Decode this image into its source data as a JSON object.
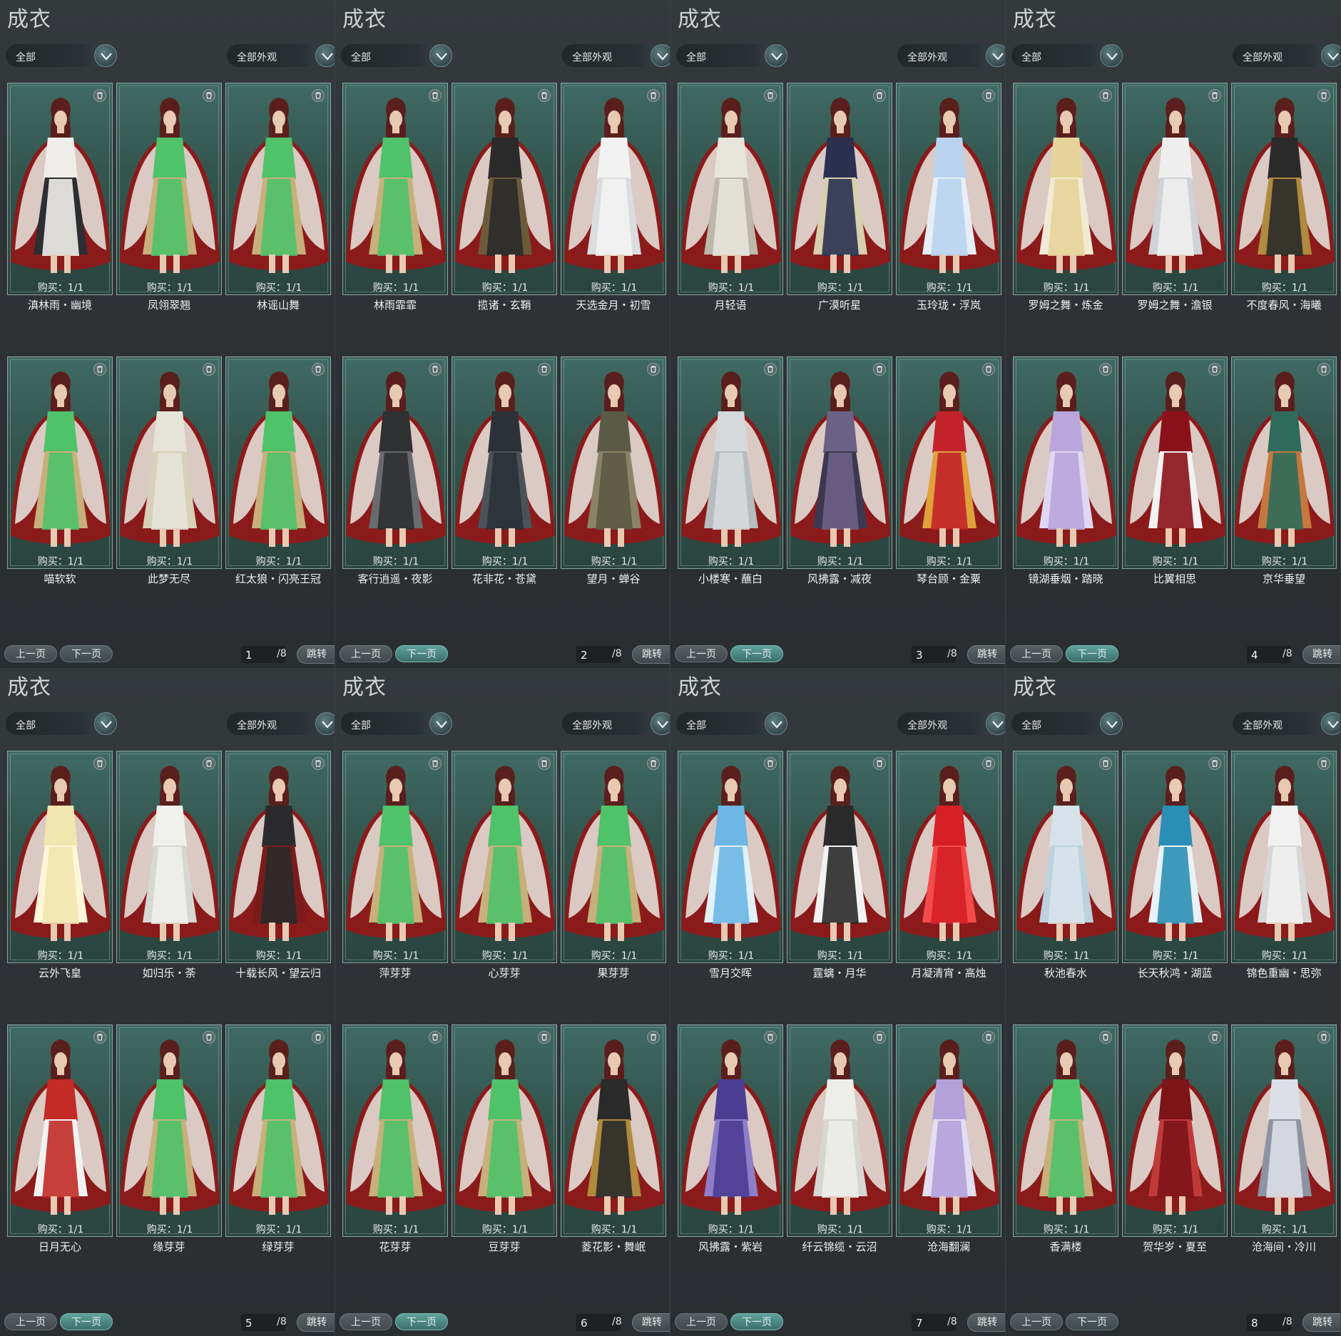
{
  "panels": [
    {
      "title": "成衣",
      "filter_left": "全部",
      "filter_right": "全部外观",
      "page": "1",
      "total": "/8",
      "prev_label": "上一页",
      "next_label": "下一页",
      "next_active": false,
      "jump_label": "跳转",
      "items": [
        {
          "buy": "购买：1/1",
          "name": "滇林雨・幽境",
          "colors": [
            "#f0eeea",
            "#2b2f33",
            "#8b1b1b"
          ]
        },
        {
          "buy": "购买：1/1",
          "name": "凤翎翠翘",
          "colors": [
            "#4fc26a",
            "#c8b07a",
            "#8b1b1b"
          ]
        },
        {
          "buy": "购买：1/1",
          "name": "林谣山舞",
          "colors": [
            "#4fc26a",
            "#c8b07a",
            "#8b1b1b"
          ]
        },
        {
          "buy": "购买：1/1",
          "name": "喵软软",
          "colors": [
            "#4fc26a",
            "#c8b07a",
            "#8b1b1b"
          ]
        },
        {
          "buy": "购买：1/1",
          "name": "此梦无尽",
          "colors": [
            "#e6e3d9",
            "#d8d1b8",
            "#8b1b1b"
          ]
        },
        {
          "buy": "购买：1/1",
          "name": "红太狼・闪亮王冠",
          "colors": [
            "#4fc26a",
            "#c8b07a",
            "#8b1b1b"
          ]
        }
      ]
    },
    {
      "title": "成衣",
      "filter_left": "全部",
      "filter_right": "全部外观",
      "page": "2",
      "total": "/8",
      "prev_label": "上一页",
      "next_label": "下一页",
      "next_active": true,
      "jump_label": "跳转",
      "items": [
        {
          "buy": "购买：1/1",
          "name": "林雨霏霏",
          "colors": [
            "#4fc26a",
            "#c8b07a",
            "#8b1b1b"
          ]
        },
        {
          "buy": "购买：1/1",
          "name": "揽诸・玄鞘",
          "colors": [
            "#2a2a2a",
            "#6b5a3a",
            "#8b1b1b"
          ]
        },
        {
          "buy": "购买：1/1",
          "name": "天选金月・初雪",
          "colors": [
            "#f2f2f2",
            "#d9dde0",
            "#8b1b1b"
          ]
        },
        {
          "buy": "购买：1/1",
          "name": "客行逍遥・夜影",
          "colors": [
            "#2f3032",
            "#6a6b6e",
            "#8b1b1b"
          ]
        },
        {
          "buy": "购买：1/1",
          "name": "花非花・苍黛",
          "colors": [
            "#2b3136",
            "#4a5258",
            "#8b1b1b"
          ]
        },
        {
          "buy": "购买：1/1",
          "name": "望月・蝉谷",
          "colors": [
            "#5b5a45",
            "#8a8366",
            "#8b1b1b"
          ]
        }
      ]
    },
    {
      "title": "成衣",
      "filter_left": "全部",
      "filter_right": "全部外观",
      "page": "3",
      "total": "/8",
      "prev_label": "上一页",
      "next_label": "下一页",
      "next_active": true,
      "jump_label": "跳转",
      "items": [
        {
          "buy": "购买：1/1",
          "name": "月轻语",
          "colors": [
            "#e7e4dc",
            "#bdb8aa",
            "#8b1b1b"
          ]
        },
        {
          "buy": "购买：1/1",
          "name": "广漠听星",
          "colors": [
            "#2a3150",
            "#d8cfae",
            "#8b1b1b"
          ]
        },
        {
          "buy": "购买：1/1",
          "name": "玉玲珑・浮岚",
          "colors": [
            "#b9d3ee",
            "#e7eef6",
            "#8b1b1b"
          ]
        },
        {
          "buy": "购买：1/1",
          "name": "小楼寒・蘸白",
          "colors": [
            "#d6d9db",
            "#b7bcbf",
            "#8b1b1b"
          ]
        },
        {
          "buy": "购买：1/1",
          "name": "风拂露・减夜",
          "colors": [
            "#6b6184",
            "#3d3850",
            "#8b1b1b"
          ]
        },
        {
          "buy": "购买：1/1",
          "name": "琴台顾・金粟",
          "colors": [
            "#c2232a",
            "#e0a13a",
            "#8b1b1b"
          ]
        }
      ]
    },
    {
      "title": "成衣",
      "filter_left": "全部",
      "filter_right": "全部外观",
      "page": "4",
      "total": "/8",
      "prev_label": "上一页",
      "next_label": "下一页",
      "next_active": true,
      "jump_label": "跳转",
      "items": [
        {
          "buy": "购买：1/1",
          "name": "罗姆之舞・炼金",
          "colors": [
            "#e7d49a",
            "#f1ead5",
            "#8b1b1b"
          ]
        },
        {
          "buy": "购买：1/1",
          "name": "罗姆之舞・澹银",
          "colors": [
            "#eeeeee",
            "#cfd2d6",
            "#8b1b1b"
          ]
        },
        {
          "buy": "购买：1/1",
          "name": "不度春风・海曦",
          "colors": [
            "#2a2a2a",
            "#b08a3e",
            "#8b1b1b"
          ]
        },
        {
          "buy": "购买：1/1",
          "name": "镜湖垂烟・踏晓",
          "colors": [
            "#b9a6dd",
            "#e0d7f2",
            "#8b1b1b"
          ]
        },
        {
          "buy": "购买：1/1",
          "name": "比翼相思",
          "colors": [
            "#8b1118",
            "#f2f2f2",
            "#8b1b1b"
          ]
        },
        {
          "buy": "购买：1/1",
          "name": "京华垂望",
          "colors": [
            "#2f6b5a",
            "#c6783f",
            "#8b1b1b"
          ]
        }
      ]
    },
    {
      "title": "成衣",
      "filter_left": "全部",
      "filter_right": "全部外观",
      "page": "5",
      "total": "/8",
      "prev_label": "上一页",
      "next_label": "下一页",
      "next_active": true,
      "jump_label": "跳转",
      "items": [
        {
          "buy": "购买：1/1",
          "name": "云外飞皇",
          "colors": [
            "#f2e6b0",
            "#fff7d8",
            "#8b1b1b"
          ]
        },
        {
          "buy": "购买：1/1",
          "name": "如归乐・荼",
          "colors": [
            "#efefec",
            "#d6d8d4",
            "#8b1b1b"
          ]
        },
        {
          "buy": "购买：1/1",
          "name": "十载长风・望云归",
          "colors": [
            "#2a2a2c",
            "#7a1b1b",
            "#8b1b1b"
          ]
        },
        {
          "buy": "购买：1/1",
          "name": "日月无心",
          "colors": [
            "#c22b26",
            "#f2f2f2",
            "#8b1b1b"
          ]
        },
        {
          "buy": "购买：1/1",
          "name": "缘芽芽",
          "colors": [
            "#4fc26a",
            "#c8b07a",
            "#8b1b1b"
          ]
        },
        {
          "buy": "购买：1/1",
          "name": "绿芽芽",
          "colors": [
            "#4fc26a",
            "#c8b07a",
            "#8b1b1b"
          ]
        }
      ]
    },
    {
      "title": "成衣",
      "filter_left": "全部",
      "filter_right": "全部外观",
      "page": "6",
      "total": "/8",
      "prev_label": "上一页",
      "next_label": "下一页",
      "next_active": true,
      "jump_label": "跳转",
      "items": [
        {
          "buy": "购买：1/1",
          "name": "萍芽芽",
          "colors": [
            "#4fc26a",
            "#c8b07a",
            "#8b1b1b"
          ]
        },
        {
          "buy": "购买：1/1",
          "name": "心芽芽",
          "colors": [
            "#4fc26a",
            "#c8b07a",
            "#8b1b1b"
          ]
        },
        {
          "buy": "购买：1/1",
          "name": "果芽芽",
          "colors": [
            "#4fc26a",
            "#c8b07a",
            "#8b1b1b"
          ]
        },
        {
          "buy": "购买：1/1",
          "name": "花芽芽",
          "colors": [
            "#4fc26a",
            "#c8b07a",
            "#8b1b1b"
          ]
        },
        {
          "buy": "购买：1/1",
          "name": "豆芽芽",
          "colors": [
            "#4fc26a",
            "#c8b07a",
            "#8b1b1b"
          ]
        },
        {
          "buy": "购买：1/1",
          "name": "菱花影・舞岷",
          "colors": [
            "#2a2a2a",
            "#b08a3e",
            "#8b1b1b"
          ]
        }
      ]
    },
    {
      "title": "成衣",
      "filter_left": "全部",
      "filter_right": "全部外观",
      "page": "7",
      "total": "/8",
      "prev_label": "上一页",
      "next_label": "下一页",
      "next_active": true,
      "jump_label": "跳转",
      "items": [
        {
          "buy": "购买：1/1",
          "name": "雪月交晖",
          "colors": [
            "#6cb7e6",
            "#e2f1fa",
            "#8b1b1b"
          ]
        },
        {
          "buy": "购买：1/1",
          "name": "霆螭・月华",
          "colors": [
            "#2a2a2a",
            "#f2f2f2",
            "#8b1b1b"
          ]
        },
        {
          "buy": "购买：1/1",
          "name": "月凝清宵・高烛",
          "colors": [
            "#d61f27",
            "#f34a4a",
            "#8b1b1b"
          ]
        },
        {
          "buy": "购买：1/1",
          "name": "风拂露・紫岩",
          "colors": [
            "#4b3d92",
            "#8e7dc7",
            "#8b1b1b"
          ]
        },
        {
          "buy": "购买：1/1",
          "name": "纤云锦缆・云沼",
          "colors": [
            "#ededea",
            "#d6d7d3",
            "#8b1b1b"
          ]
        },
        {
          "buy": "购买：1/1",
          "name": "沧海翻澜",
          "colors": [
            "#b3a2da",
            "#e3def1",
            "#8b1b1b"
          ]
        }
      ]
    },
    {
      "title": "成衣",
      "filter_left": "全部",
      "filter_right": "全部外观",
      "page": "8",
      "total": "/8",
      "prev_label": "上一页",
      "next_label": "下一页",
      "next_active": false,
      "jump_label": "跳转",
      "items": [
        {
          "buy": "购买：1/1",
          "name": "秋池春水",
          "colors": [
            "#d7e3ea",
            "#bcd2df",
            "#8b1b1b"
          ]
        },
        {
          "buy": "购买：1/1",
          "name": "长天秋鸿・湖蓝",
          "colors": [
            "#2b8fb5",
            "#e9f2f6",
            "#8b1b1b"
          ]
        },
        {
          "buy": "购买：1/1",
          "name": "锦色重幽・思弥",
          "colors": [
            "#f1f1f1",
            "#d8d8d8",
            "#8b1b1b"
          ]
        },
        {
          "buy": "购买：1/1",
          "name": "香满楼",
          "colors": [
            "#4fc26a",
            "#c8b07a",
            "#8b1b1b"
          ]
        },
        {
          "buy": "购买：1/1",
          "name": "贺华岁・夏至",
          "colors": [
            "#7d1418",
            "#c03a3a",
            "#8b1b1b"
          ]
        },
        {
          "buy": "购买：1/1",
          "name": "沧海间・冷川",
          "colors": [
            "#dcdfe6",
            "#8d93a2",
            "#8b1b1b"
          ]
        }
      ]
    }
  ]
}
